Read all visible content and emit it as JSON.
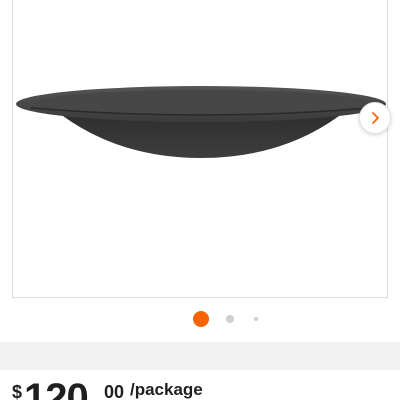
{
  "gallery": {
    "image_alt": "Black steel fire pit bowl",
    "next_icon": "chevron-right-icon",
    "slide_count": 3,
    "active_slide": 1
  },
  "price": {
    "currency_symbol": "$",
    "whole": "120",
    "cents": "00",
    "unit": "/package"
  },
  "colors": {
    "accent": "#f96302",
    "dot_inactive": "#cfcfcf",
    "bowl": "#3a3a3a",
    "band": "#f1f1f1"
  }
}
